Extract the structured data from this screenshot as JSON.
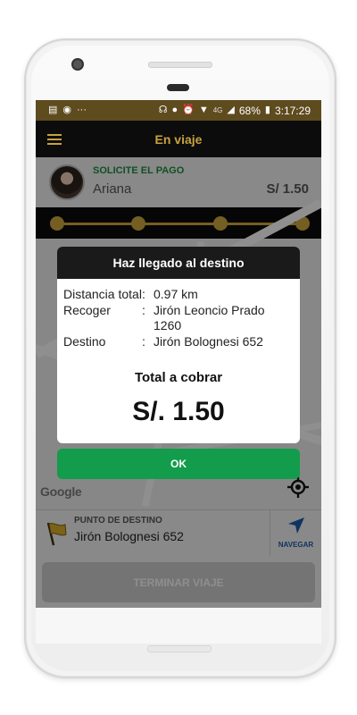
{
  "status_bar": {
    "network": "4G",
    "battery": "68%",
    "time": "3:17:29",
    "more": "···"
  },
  "app_bar": {
    "title": "En viaje"
  },
  "driver_card": {
    "status": "SOLICITE EL PAGO",
    "passenger": "Ariana",
    "fare": "S/ 1.50"
  },
  "progress": {
    "steps": 4,
    "completed": 4
  },
  "dialog": {
    "title": "Haz llegado al destino",
    "rows": [
      {
        "label": "Distancia total",
        "sep": ":",
        "value": "0.97 km"
      },
      {
        "label": "Recoger",
        "sep": ":",
        "value": "Jirón Leoncio Prado 1260"
      },
      {
        "label": "Destino",
        "sep": ":",
        "value": "Jirón Bolognesi 652"
      }
    ],
    "total_label": "Total a cobrar",
    "total_amount": "S/. 1.50",
    "ok_label": "OK"
  },
  "map": {
    "logo": "Google"
  },
  "destination": {
    "label": "PUNTO DE DESTINO",
    "value": "Jirón Bolognesi 652",
    "navigate_label": "NAVEGAR"
  },
  "actions": {
    "finish_label": "TERMINAR VIAJE"
  },
  "colors": {
    "brand_gold": "#c9a23c",
    "status_bar": "#5e4b1e",
    "ok_green": "#129c4c",
    "pay_green": "#1e8a3f"
  }
}
